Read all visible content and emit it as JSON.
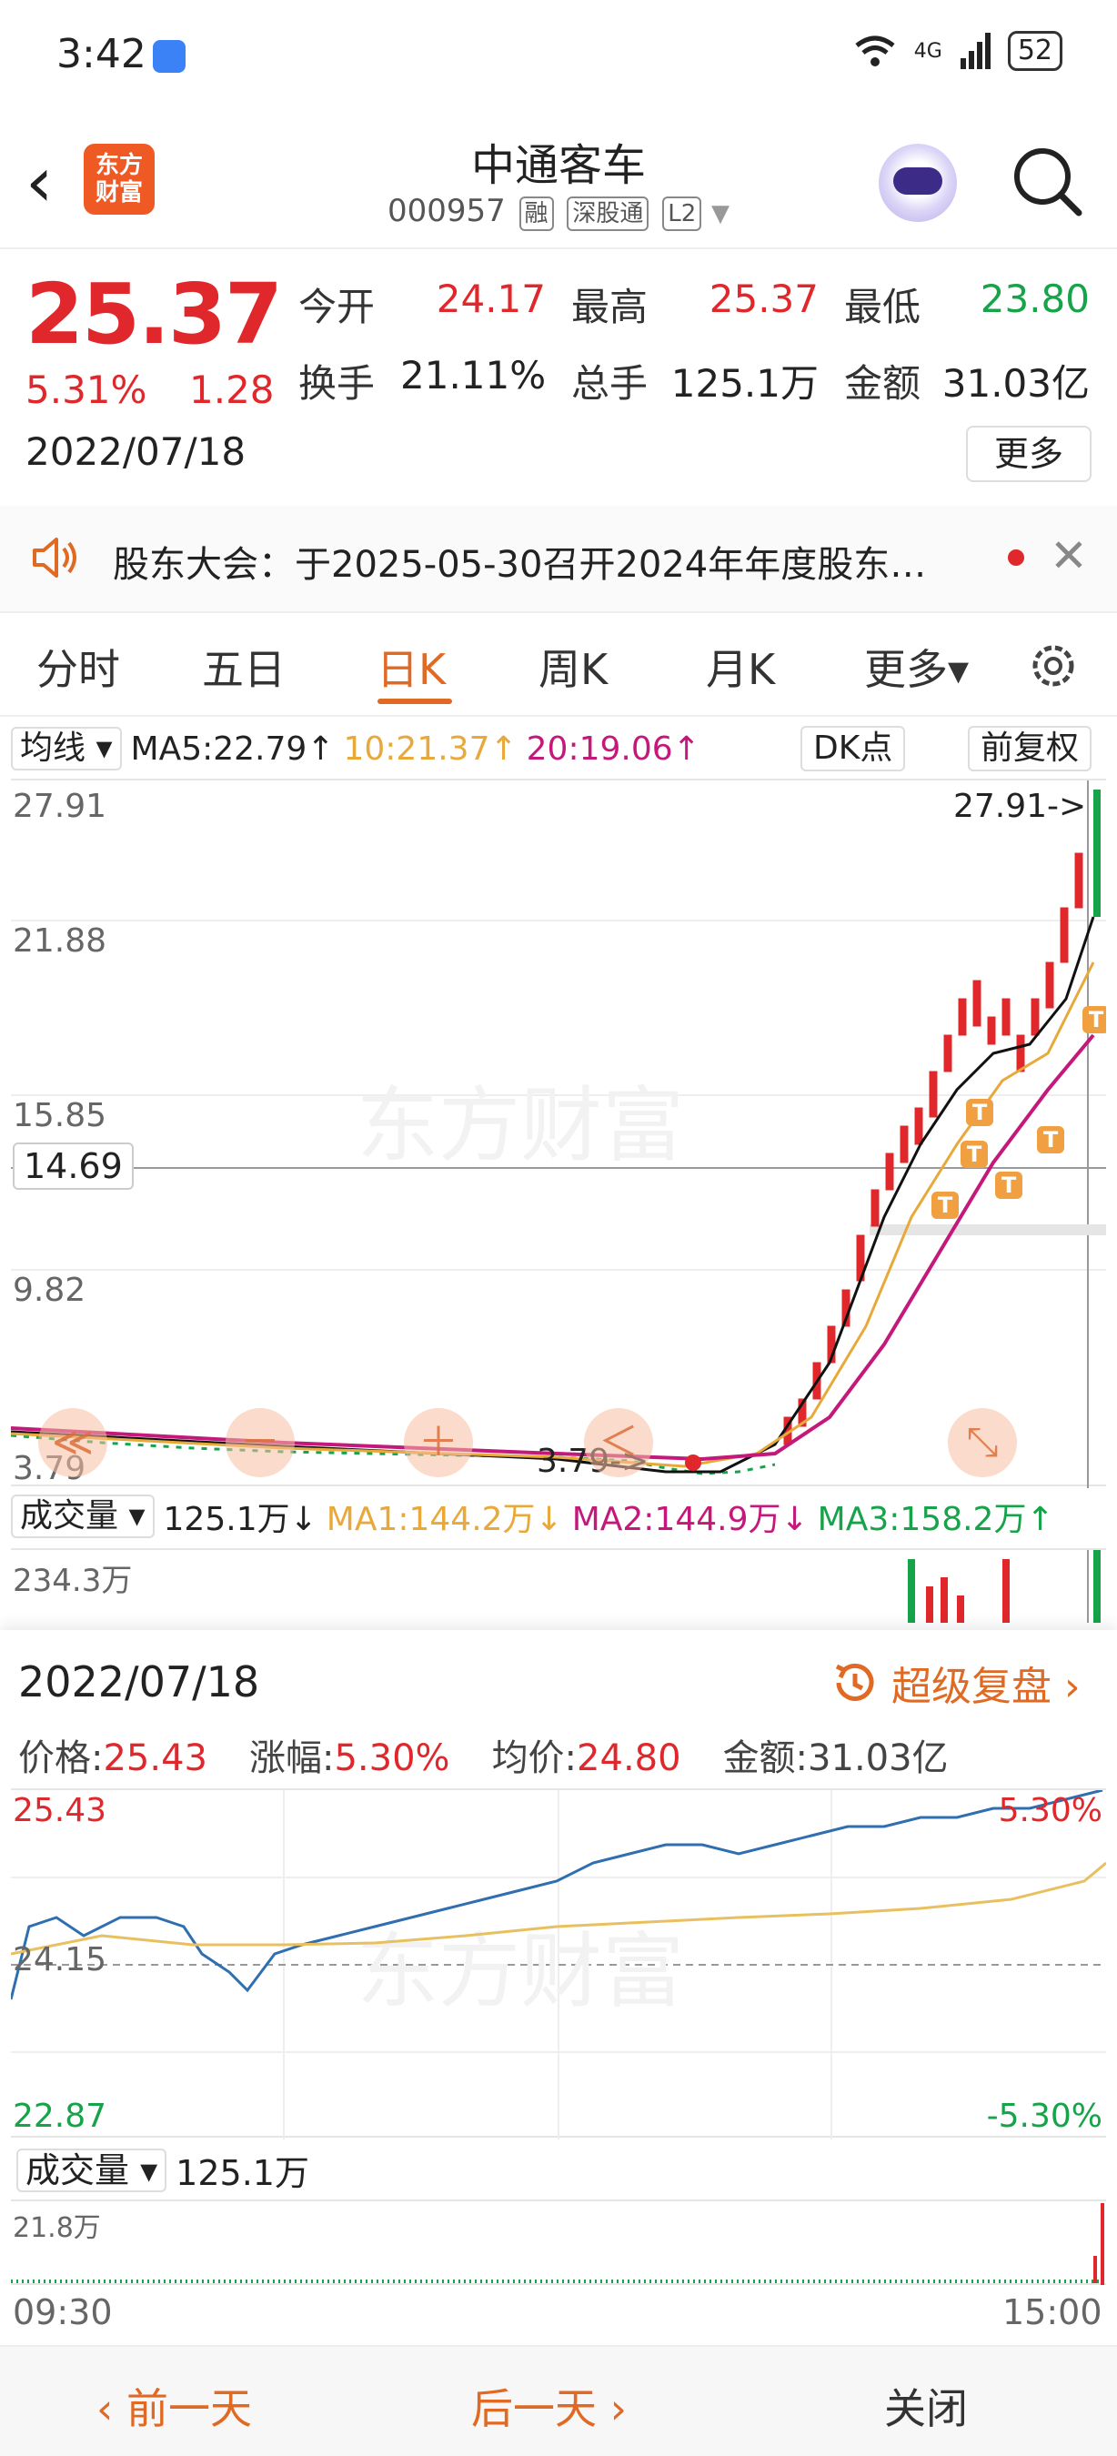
{
  "status_bar": {
    "time": "3:42",
    "network": "4G",
    "battery": "52"
  },
  "header": {
    "name": "中通客车",
    "code": "000957",
    "tags": [
      "融",
      "深股通",
      "L2"
    ],
    "logo_text_1": "东方",
    "logo_text_2": "财富"
  },
  "quote": {
    "price": "25.37",
    "change_pct": "5.31%",
    "change": "1.28",
    "date": "2022/07/18",
    "open_label": "今开",
    "open": "24.17",
    "high_label": "最高",
    "high": "25.37",
    "low_label": "最低",
    "low": "23.80",
    "turnover_label": "换手",
    "turnover": "21.11%",
    "volume_label": "总手",
    "volume": "125.1万",
    "amount_label": "金额",
    "amount": "31.03亿",
    "more": "更多"
  },
  "notice": {
    "text": "股东大会：于2025-05-30召开2024年年度股东…"
  },
  "tabs": {
    "t1": "分时",
    "t2": "五日",
    "t3": "日K",
    "t4": "周K",
    "t5": "月K",
    "t6": "更多▾"
  },
  "ma_row": {
    "selector": "均线",
    "ma5": "MA5:22.79↑",
    "ma10": "10:21.37↑",
    "ma20": "20:19.06↑",
    "dk": "DK点",
    "adj": "前复权"
  },
  "kline": {
    "y_labels": [
      "27.91",
      "21.88",
      "15.85",
      "9.82",
      "3.79"
    ],
    "max_label": "27.91->",
    "min_label": "3.79->",
    "hover_price": "14.69",
    "controls": [
      "≪",
      "－",
      "＋",
      "＜",
      "⤡"
    ],
    "colors": {
      "up": "#e0282c",
      "down": "#16a34a",
      "ma5": "#111111",
      "ma10": "#e8a93a",
      "ma20": "#c4197a"
    }
  },
  "volume": {
    "selector": "成交量",
    "value": "125.1万↓",
    "ma1": "MA1:144.2万↓",
    "ma2": "MA2:144.9万↓",
    "ma3": "MA3:158.2万↑",
    "y_top": "234.3万"
  },
  "panel": {
    "date": "2022/07/18",
    "replay": "超级复盘 ›",
    "price_label": "价格:",
    "price": "25.43",
    "pct_label": "涨幅:",
    "pct": "5.30%",
    "avg_label": "均价:",
    "avg": "24.80",
    "amount_label": "金额:",
    "amount": "31.03亿",
    "y_high": "25.43",
    "y_mid": "24.15",
    "y_low": "22.87",
    "pct_high": "5.30%",
    "pct_low": "-5.30%",
    "vol_selector": "成交量",
    "vol_value": "125.1万",
    "vol_top": "21.8万",
    "time_start": "09:30",
    "time_end": "15:00"
  },
  "bottom": {
    "prev": "‹ 前一天",
    "next": "后一天 ›",
    "close": "关闭"
  }
}
